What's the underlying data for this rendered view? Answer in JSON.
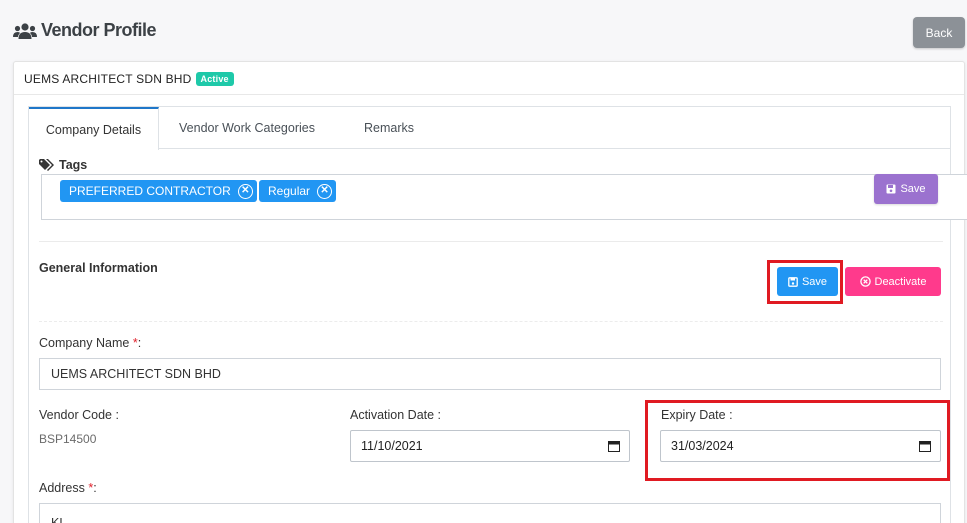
{
  "header": {
    "title": "Vendor Profile",
    "title_icon": "users-icon",
    "back_label": "Back"
  },
  "company": {
    "name": "UEMS ARCHITECT SDN BHD",
    "status_badge": "Active"
  },
  "tabs": [
    {
      "label": "Company Details",
      "active": true
    },
    {
      "label": "Vendor Work Categories",
      "active": false
    },
    {
      "label": "Remarks",
      "active": false
    }
  ],
  "tags": {
    "label": "Tags",
    "items": [
      {
        "label": "PREFERRED CONTRACTOR"
      },
      {
        "label": "Regular"
      }
    ],
    "save_label": "Save"
  },
  "general": {
    "title": "General Information",
    "save_label": "Save",
    "deactivate_label": "Deactivate"
  },
  "form": {
    "company_name_label": "Company Name",
    "company_name_value": "UEMS ARCHITECT SDN BHD",
    "vendor_code_label": "Vendor Code :",
    "vendor_code_value": "BSP14500",
    "activation_label": "Activation Date :",
    "activation_value": "11/10/2021",
    "expiry_label": "Expiry Date :",
    "expiry_value": "31/03/2024",
    "address_label": "Address",
    "address_value": "KL",
    "required_mark": "*",
    "colon": ":"
  },
  "colors": {
    "primary": "#2196f3",
    "purple": "#9b72cf",
    "pink": "#ff3a8c",
    "badge": "#1ec9a9",
    "highlight": "#e01a22"
  }
}
